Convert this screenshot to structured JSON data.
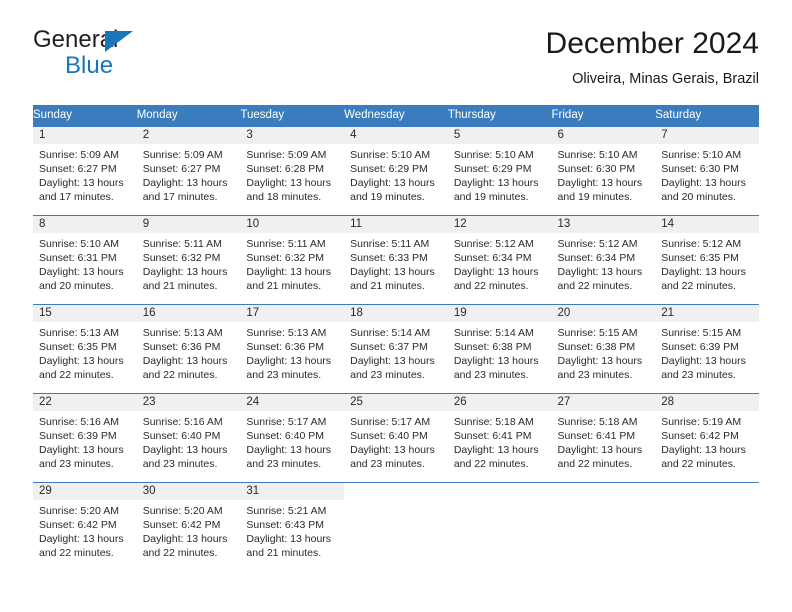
{
  "brand": {
    "name_part1": "General",
    "name_part2": "Blue",
    "triangle_color": "#1b75bb"
  },
  "header": {
    "title": "December 2024",
    "subtitle": "Oliveira, Minas Gerais, Brazil"
  },
  "theme": {
    "header_blue": "#3a7cbe",
    "daynum_band": "#f0f0f0",
    "text": "#2a2a2a"
  },
  "weekdays": [
    "Sunday",
    "Monday",
    "Tuesday",
    "Wednesday",
    "Thursday",
    "Friday",
    "Saturday"
  ],
  "weeks": [
    [
      {
        "day": "1",
        "sunrise": "Sunrise: 5:09 AM",
        "sunset": "Sunset: 6:27 PM",
        "daylight_line1": "Daylight: 13 hours",
        "daylight_line2": "and 17 minutes."
      },
      {
        "day": "2",
        "sunrise": "Sunrise: 5:09 AM",
        "sunset": "Sunset: 6:27 PM",
        "daylight_line1": "Daylight: 13 hours",
        "daylight_line2": "and 17 minutes."
      },
      {
        "day": "3",
        "sunrise": "Sunrise: 5:09 AM",
        "sunset": "Sunset: 6:28 PM",
        "daylight_line1": "Daylight: 13 hours",
        "daylight_line2": "and 18 minutes."
      },
      {
        "day": "4",
        "sunrise": "Sunrise: 5:10 AM",
        "sunset": "Sunset: 6:29 PM",
        "daylight_line1": "Daylight: 13 hours",
        "daylight_line2": "and 19 minutes."
      },
      {
        "day": "5",
        "sunrise": "Sunrise: 5:10 AM",
        "sunset": "Sunset: 6:29 PM",
        "daylight_line1": "Daylight: 13 hours",
        "daylight_line2": "and 19 minutes."
      },
      {
        "day": "6",
        "sunrise": "Sunrise: 5:10 AM",
        "sunset": "Sunset: 6:30 PM",
        "daylight_line1": "Daylight: 13 hours",
        "daylight_line2": "and 19 minutes."
      },
      {
        "day": "7",
        "sunrise": "Sunrise: 5:10 AM",
        "sunset": "Sunset: 6:30 PM",
        "daylight_line1": "Daylight: 13 hours",
        "daylight_line2": "and 20 minutes."
      }
    ],
    [
      {
        "day": "8",
        "sunrise": "Sunrise: 5:10 AM",
        "sunset": "Sunset: 6:31 PM",
        "daylight_line1": "Daylight: 13 hours",
        "daylight_line2": "and 20 minutes."
      },
      {
        "day": "9",
        "sunrise": "Sunrise: 5:11 AM",
        "sunset": "Sunset: 6:32 PM",
        "daylight_line1": "Daylight: 13 hours",
        "daylight_line2": "and 21 minutes."
      },
      {
        "day": "10",
        "sunrise": "Sunrise: 5:11 AM",
        "sunset": "Sunset: 6:32 PM",
        "daylight_line1": "Daylight: 13 hours",
        "daylight_line2": "and 21 minutes."
      },
      {
        "day": "11",
        "sunrise": "Sunrise: 5:11 AM",
        "sunset": "Sunset: 6:33 PM",
        "daylight_line1": "Daylight: 13 hours",
        "daylight_line2": "and 21 minutes."
      },
      {
        "day": "12",
        "sunrise": "Sunrise: 5:12 AM",
        "sunset": "Sunset: 6:34 PM",
        "daylight_line1": "Daylight: 13 hours",
        "daylight_line2": "and 22 minutes."
      },
      {
        "day": "13",
        "sunrise": "Sunrise: 5:12 AM",
        "sunset": "Sunset: 6:34 PM",
        "daylight_line1": "Daylight: 13 hours",
        "daylight_line2": "and 22 minutes."
      },
      {
        "day": "14",
        "sunrise": "Sunrise: 5:12 AM",
        "sunset": "Sunset: 6:35 PM",
        "daylight_line1": "Daylight: 13 hours",
        "daylight_line2": "and 22 minutes."
      }
    ],
    [
      {
        "day": "15",
        "sunrise": "Sunrise: 5:13 AM",
        "sunset": "Sunset: 6:35 PM",
        "daylight_line1": "Daylight: 13 hours",
        "daylight_line2": "and 22 minutes."
      },
      {
        "day": "16",
        "sunrise": "Sunrise: 5:13 AM",
        "sunset": "Sunset: 6:36 PM",
        "daylight_line1": "Daylight: 13 hours",
        "daylight_line2": "and 22 minutes."
      },
      {
        "day": "17",
        "sunrise": "Sunrise: 5:13 AM",
        "sunset": "Sunset: 6:36 PM",
        "daylight_line1": "Daylight: 13 hours",
        "daylight_line2": "and 23 minutes."
      },
      {
        "day": "18",
        "sunrise": "Sunrise: 5:14 AM",
        "sunset": "Sunset: 6:37 PM",
        "daylight_line1": "Daylight: 13 hours",
        "daylight_line2": "and 23 minutes."
      },
      {
        "day": "19",
        "sunrise": "Sunrise: 5:14 AM",
        "sunset": "Sunset: 6:38 PM",
        "daylight_line1": "Daylight: 13 hours",
        "daylight_line2": "and 23 minutes."
      },
      {
        "day": "20",
        "sunrise": "Sunrise: 5:15 AM",
        "sunset": "Sunset: 6:38 PM",
        "daylight_line1": "Daylight: 13 hours",
        "daylight_line2": "and 23 minutes."
      },
      {
        "day": "21",
        "sunrise": "Sunrise: 5:15 AM",
        "sunset": "Sunset: 6:39 PM",
        "daylight_line1": "Daylight: 13 hours",
        "daylight_line2": "and 23 minutes."
      }
    ],
    [
      {
        "day": "22",
        "sunrise": "Sunrise: 5:16 AM",
        "sunset": "Sunset: 6:39 PM",
        "daylight_line1": "Daylight: 13 hours",
        "daylight_line2": "and 23 minutes."
      },
      {
        "day": "23",
        "sunrise": "Sunrise: 5:16 AM",
        "sunset": "Sunset: 6:40 PM",
        "daylight_line1": "Daylight: 13 hours",
        "daylight_line2": "and 23 minutes."
      },
      {
        "day": "24",
        "sunrise": "Sunrise: 5:17 AM",
        "sunset": "Sunset: 6:40 PM",
        "daylight_line1": "Daylight: 13 hours",
        "daylight_line2": "and 23 minutes."
      },
      {
        "day": "25",
        "sunrise": "Sunrise: 5:17 AM",
        "sunset": "Sunset: 6:40 PM",
        "daylight_line1": "Daylight: 13 hours",
        "daylight_line2": "and 23 minutes."
      },
      {
        "day": "26",
        "sunrise": "Sunrise: 5:18 AM",
        "sunset": "Sunset: 6:41 PM",
        "daylight_line1": "Daylight: 13 hours",
        "daylight_line2": "and 22 minutes."
      },
      {
        "day": "27",
        "sunrise": "Sunrise: 5:18 AM",
        "sunset": "Sunset: 6:41 PM",
        "daylight_line1": "Daylight: 13 hours",
        "daylight_line2": "and 22 minutes."
      },
      {
        "day": "28",
        "sunrise": "Sunrise: 5:19 AM",
        "sunset": "Sunset: 6:42 PM",
        "daylight_line1": "Daylight: 13 hours",
        "daylight_line2": "and 22 minutes."
      }
    ],
    [
      {
        "day": "29",
        "sunrise": "Sunrise: 5:20 AM",
        "sunset": "Sunset: 6:42 PM",
        "daylight_line1": "Daylight: 13 hours",
        "daylight_line2": "and 22 minutes."
      },
      {
        "day": "30",
        "sunrise": "Sunrise: 5:20 AM",
        "sunset": "Sunset: 6:42 PM",
        "daylight_line1": "Daylight: 13 hours",
        "daylight_line2": "and 22 minutes."
      },
      {
        "day": "31",
        "sunrise": "Sunrise: 5:21 AM",
        "sunset": "Sunset: 6:43 PM",
        "daylight_line1": "Daylight: 13 hours",
        "daylight_line2": "and 21 minutes."
      },
      {
        "day": "",
        "sunrise": "",
        "sunset": "",
        "daylight_line1": "",
        "daylight_line2": ""
      },
      {
        "day": "",
        "sunrise": "",
        "sunset": "",
        "daylight_line1": "",
        "daylight_line2": ""
      },
      {
        "day": "",
        "sunrise": "",
        "sunset": "",
        "daylight_line1": "",
        "daylight_line2": ""
      },
      {
        "day": "",
        "sunrise": "",
        "sunset": "",
        "daylight_line1": "",
        "daylight_line2": ""
      }
    ]
  ]
}
